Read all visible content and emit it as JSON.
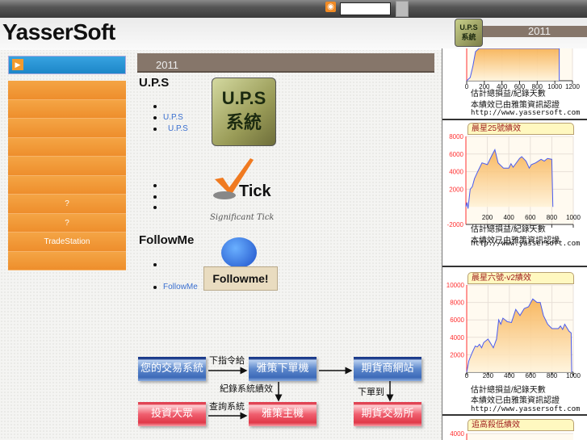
{
  "topbar": {
    "rss_icon": "rss-icon",
    "search_value": ""
  },
  "header": {
    "logo": "YasserSoft",
    "year": "2011",
    "badge": "U.P.S 系統"
  },
  "sidebar": {
    "items": [
      "",
      "",
      "",
      "",
      "",
      "",
      "?",
      "?",
      "TradeStation",
      ""
    ]
  },
  "main": {
    "heading": "2011",
    "ups": {
      "title": "U.P.S",
      "links": [
        "",
        "U.P.S",
        "U.P.S"
      ],
      "logo": "U.P.S 系統"
    },
    "tick": {
      "items": [
        "",
        "",
        ""
      ],
      "logo": "Tick",
      "tagline": "Significant Tick"
    },
    "followme": {
      "title": "FollowMe",
      "links": [
        "",
        "FollowMe"
      ],
      "logo": "Followme!"
    },
    "diagram": {
      "boxes": [
        "您的交易系統",
        "雅策下單機",
        "期貨商網站",
        "投資大眾",
        "雅策主機",
        "期貨交易所"
      ],
      "labels": [
        "下指令給",
        "紀錄系統績效",
        "下單到",
        "查詢系統"
      ]
    }
  },
  "colors": {
    "accent_blue": "#1d86c8",
    "menu_orange": "#f29a3a",
    "bar_brown": "#86766a",
    "series_line": "#4a5cf0",
    "axis_red": "#ff3030"
  },
  "captions": {
    "line1": "估計總損益/紀錄天數",
    "line2": "本績效已由雅策資訊認證",
    "url": "http://www.yassersoft.com"
  },
  "chart_data": [
    {
      "type": "area",
      "title": "",
      "xlabel": "估計總損益/紀錄天數",
      "x_ticks": [
        0,
        200,
        400,
        600,
        800,
        1000,
        1200
      ],
      "xlim": [
        0,
        1200
      ],
      "ylim": [
        0,
        3000
      ],
      "y_ticks": [],
      "series": [
        {
          "x": [
            0,
            40,
            70,
            100,
            140,
            180,
            1050,
            1050
          ],
          "y": [
            0,
            200,
            900,
            1800,
            2600,
            3000,
            3000,
            0
          ]
        }
      ]
    },
    {
      "type": "area",
      "title": "晨星25號績效",
      "xlabel": "估計總損益/紀錄天數",
      "x_ticks": [
        200,
        400,
        600,
        800,
        1000
      ],
      "xlim": [
        0,
        1000
      ],
      "y_ticks": [
        -2000,
        2000,
        4000,
        6000,
        8000
      ],
      "ylim": [
        -2000,
        8000
      ],
      "series": [
        {
          "x": [
            0,
            10,
            20,
            40,
            60,
            80,
            110,
            150,
            200,
            240,
            270,
            300,
            350,
            400,
            420,
            440,
            500,
            520,
            560,
            590,
            610,
            650,
            700,
            730,
            760,
            800,
            810
          ],
          "y": [
            0,
            500,
            -200,
            2000,
            2300,
            3200,
            4000,
            5000,
            4800,
            5800,
            6500,
            5000,
            4400,
            4400,
            4900,
            4500,
            5500,
            5700,
            5200,
            4400,
            4800,
            5000,
            5400,
            5200,
            5500,
            5400,
            0
          ]
        }
      ]
    },
    {
      "type": "area",
      "title": "晨星六號-v2績效",
      "xlabel": "估計總損益/紀錄天數",
      "x_ticks": [
        0,
        200,
        400,
        600,
        800,
        1000
      ],
      "xlim": [
        0,
        1000
      ],
      "y_ticks": [
        2000,
        4000,
        6000,
        8000,
        10000
      ],
      "ylim": [
        0,
        10000
      ],
      "series": [
        {
          "x": [
            0,
            20,
            50,
            80,
            100,
            120,
            140,
            160,
            200,
            250,
            280,
            300,
            320,
            340,
            380,
            420,
            460,
            500,
            540,
            580,
            620,
            660,
            690,
            720,
            760,
            800,
            860,
            880,
            900,
            920,
            960,
            980,
            985
          ],
          "y": [
            0,
            1300,
            2200,
            3000,
            2900,
            3200,
            2800,
            3400,
            3800,
            2800,
            3800,
            6000,
            5500,
            6200,
            5800,
            5700,
            7200,
            6500,
            7300,
            7500,
            8400,
            8000,
            8000,
            6500,
            5500,
            5000,
            5000,
            5300,
            4900,
            5500,
            4700,
            4500,
            0
          ]
        }
      ]
    },
    {
      "type": "area",
      "title": "追高殺低績效",
      "y_ticks": [
        4000
      ]
    }
  ]
}
